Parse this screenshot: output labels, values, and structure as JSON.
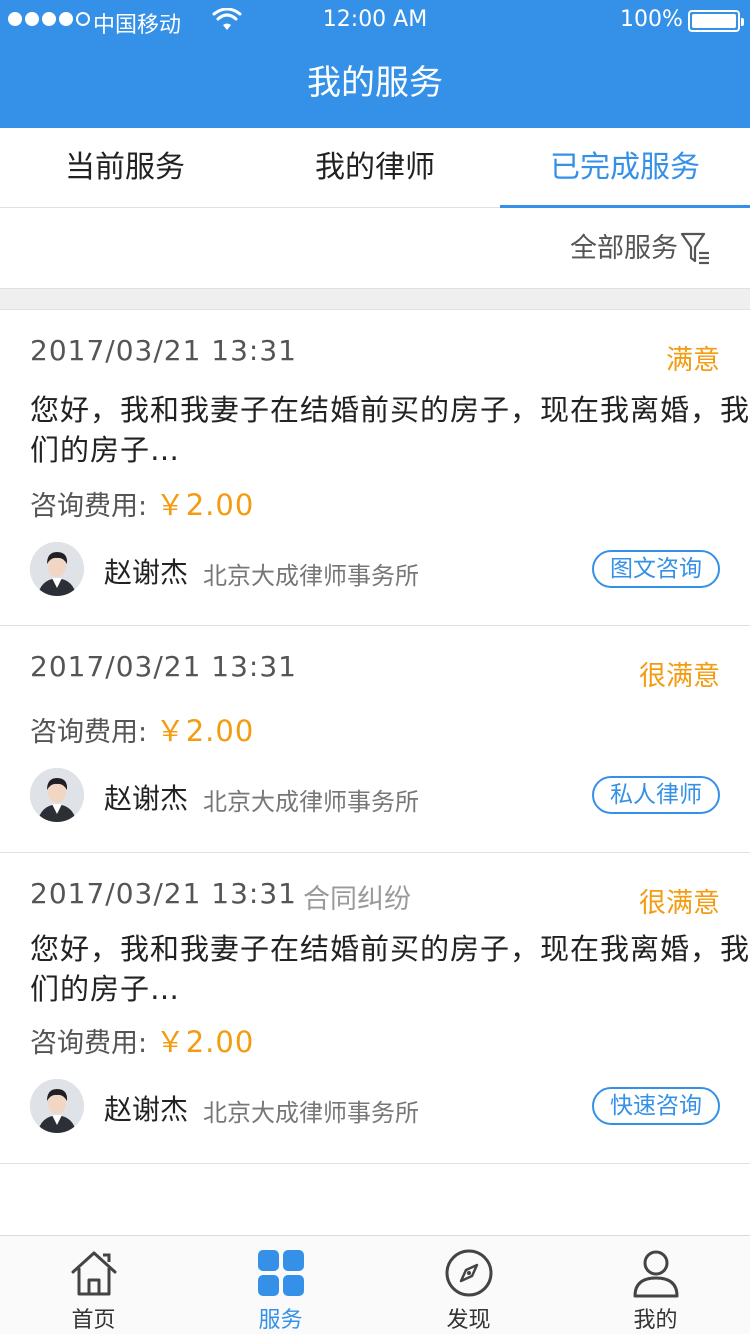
{
  "status_bar": {
    "carrier": "中国移动",
    "time": "12:00 AM",
    "battery": "100%"
  },
  "header": {
    "title": "我的服务"
  },
  "tabs": [
    {
      "label": "当前服务",
      "active": false
    },
    {
      "label": "我的律师",
      "active": false
    },
    {
      "label": "已完成服务",
      "active": true
    }
  ],
  "filter": {
    "label": "全部服务",
    "icon": "filter-icon"
  },
  "orders": [
    {
      "date": "2017/03/21 13:31",
      "category": "",
      "rating": "满意",
      "question": "您好，我和我妻子在结婚前买的房子，现在我离婚，我们的房子…",
      "fee_label": "咨询费用:",
      "fee_amount": "￥2.00",
      "lawyer_name": "赵谢杰",
      "firm": "北京大成律师事务所",
      "service_type": "图文咨询"
    },
    {
      "date": "2017/03/21 13:31",
      "category": "",
      "rating": "很满意",
      "question": "",
      "fee_label": "咨询费用:",
      "fee_amount": "￥2.00",
      "lawyer_name": "赵谢杰",
      "firm": "北京大成律师事务所",
      "service_type": "私人律师"
    },
    {
      "date": "2017/03/21 13:31",
      "category": "合同纠纷",
      "rating": "很满意",
      "question": "您好，我和我妻子在结婚前买的房子，现在我离婚，我们的房子…",
      "fee_label": "咨询费用:",
      "fee_amount": "￥2.00",
      "lawyer_name": "赵谢杰",
      "firm": "北京大成律师事务所",
      "service_type": "快速咨询"
    }
  ],
  "bottom_nav": [
    {
      "label": "首页",
      "icon": "home-icon",
      "active": false
    },
    {
      "label": "服务",
      "icon": "grid-icon",
      "active": true
    },
    {
      "label": "发现",
      "icon": "compass-icon",
      "active": false
    },
    {
      "label": "我的",
      "icon": "user-icon",
      "active": false
    }
  ],
  "colors": {
    "primary": "#3591e8",
    "accent": "#f39c12"
  }
}
